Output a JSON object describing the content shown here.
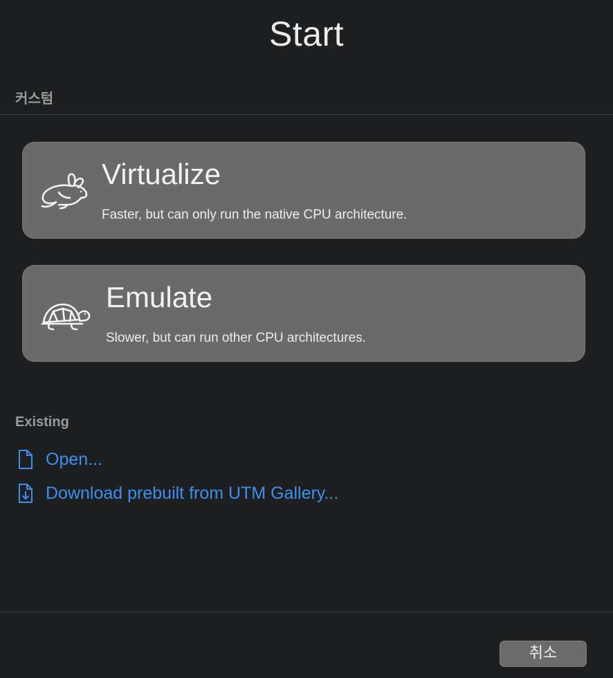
{
  "window": {
    "title": "Start"
  },
  "custom_section": {
    "label": "커스텀"
  },
  "options": [
    {
      "title": "Virtualize",
      "description": "Faster, but can only run the native CPU architecture.",
      "icon": "rabbit-icon"
    },
    {
      "title": "Emulate",
      "description": "Slower, but can run other CPU architectures.",
      "icon": "turtle-icon"
    }
  ],
  "existing_section": {
    "label": "Existing",
    "links": [
      {
        "label": "Open...",
        "icon": "document-icon"
      },
      {
        "label": "Download prebuilt from UTM Gallery...",
        "icon": "document-download-icon"
      }
    ]
  },
  "footer": {
    "cancel_label": "취소"
  },
  "colors": {
    "background": "#1e1f20",
    "card": "#6a6a6a",
    "link": "#3d8ff2",
    "section_label": "#9a9a9a"
  }
}
